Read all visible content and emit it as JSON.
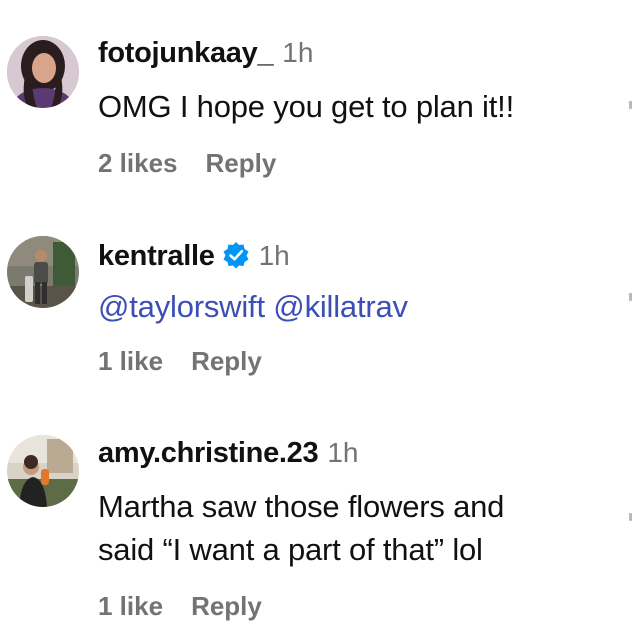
{
  "comments": [
    {
      "username": "fotojunkaay_",
      "time": "1h",
      "text": "OMG I hope you get to plan it!!",
      "likes": "2 likes",
      "reply": "Reply",
      "verified": false
    },
    {
      "username": "kentralle",
      "time": "1h",
      "mention1": "@taylorswift",
      "mention2": "@killatrav",
      "likes": "1 like",
      "reply": "Reply",
      "verified": true
    },
    {
      "username": "amy.christine.23",
      "time": "1h",
      "text_line1": "Martha saw those flowers and",
      "text_line2": "said “I want a part of that” lol",
      "likes": "1 like",
      "reply": "Reply",
      "verified": false
    }
  ],
  "colors": {
    "mention": "#3c4fb6",
    "verified_badge": "#0095f6",
    "muted": "#737373"
  },
  "icons": {
    "verified": "verified-badge-icon"
  }
}
